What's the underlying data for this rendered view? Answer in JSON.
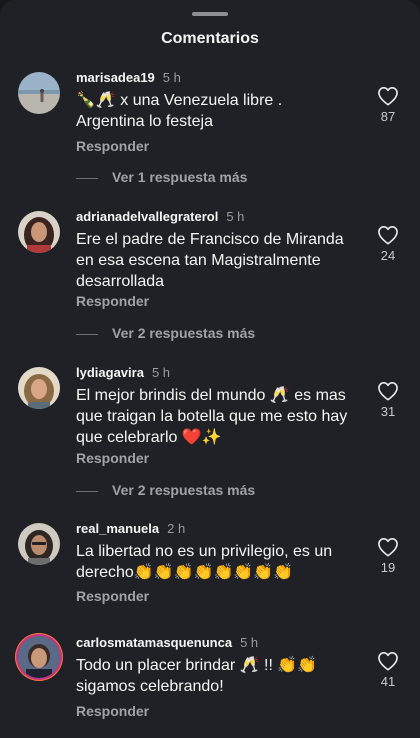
{
  "sheet": {
    "title": "Comentarios"
  },
  "comments": [
    {
      "username": "marisadea19",
      "time": "5 h",
      "text": "🍾🥂 x una Venezuela libre . Argentina lo festeja",
      "reply_label": "Responder",
      "likes": "87",
      "more_replies": "Ver 1 respuesta más",
      "avatar": "avatar-beach"
    },
    {
      "username": "adrianadelvallegraterol",
      "time": "5 h",
      "text": "Ere el padre de Francisco de Miranda en esa escena tan Magistralmente desarrollada",
      "reply_label": "Responder",
      "likes": "24",
      "more_replies": "Ver 2 respuestas más",
      "avatar": "avatar-woman-dark-hair"
    },
    {
      "username": "lydiagavira",
      "time": "5 h",
      "text": "El mejor brindis del mundo 🥂 es mas que traigan la botella que me esto hay que celebrarlo ❤️✨",
      "reply_label": "Responder",
      "likes": "31",
      "more_replies": "Ver 2 respuestas más",
      "avatar": "avatar-woman-light-hair"
    },
    {
      "username": "real_manuela",
      "time": "2 h",
      "text": "La libertad no es un privilegio, es un derecho👏👏👏👏👏👏👏👏",
      "reply_label": "Responder",
      "likes": "19",
      "avatar": "avatar-woman-glasses"
    },
    {
      "username": "carlosmatamasquenunca",
      "time": "5 h",
      "text": "Todo un placer brindar 🥂 !! 👏👏 sigamos celebrando!",
      "reply_label": "Responder",
      "likes": "41",
      "avatar": "avatar-man-story-ring"
    }
  ],
  "colors": {
    "background": "#202126",
    "text": "#f5f5f5",
    "muted": "#a1a2a7",
    "story_ring": "#c13584"
  },
  "icons": [
    "heart-outline-icon",
    "drag-handle"
  ]
}
